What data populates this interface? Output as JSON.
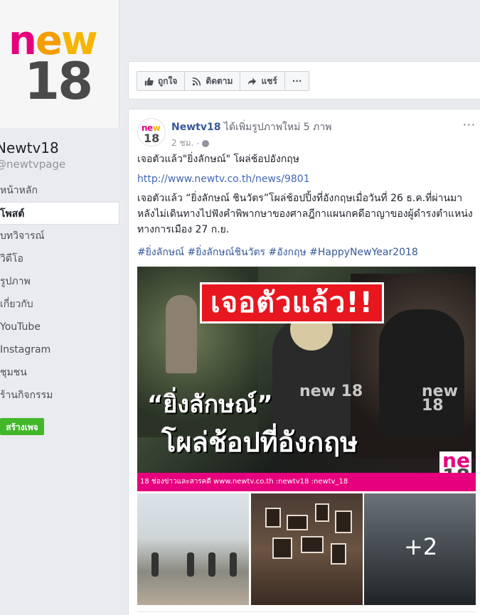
{
  "page": {
    "name": "Newtv18",
    "handle": "@newtvpage",
    "logo": {
      "top": "new",
      "bottom": "18"
    }
  },
  "nav": {
    "items": [
      {
        "label": "หน้าหลัก",
        "id": "home"
      },
      {
        "label": "โพสต์",
        "id": "posts",
        "active": true
      },
      {
        "label": "บทวิจารณ์",
        "id": "reviews"
      },
      {
        "label": "วิดีโอ",
        "id": "videos"
      },
      {
        "label": "รูปภาพ",
        "id": "photos"
      },
      {
        "label": "เกี่ยวกับ",
        "id": "about"
      },
      {
        "label": "YouTube",
        "id": "youtube"
      },
      {
        "label": "Instagram",
        "id": "instagram"
      },
      {
        "label": "ชุมชน",
        "id": "community"
      },
      {
        "label": "ร้านกิจกรรม",
        "id": "events"
      }
    ],
    "create_page_label": "สร้างเพจ"
  },
  "actions": {
    "like_label": "ถูกใจ",
    "follow_label": "ติดตาม",
    "share_label": "แชร์",
    "more_label": "···"
  },
  "post": {
    "author": "Newtv18",
    "action_text": "ได้เพิ่มรูปภาพใหม่ 5 ภาพ",
    "time": "2 ชม.",
    "title": "เจอตัวแล้ว\"ยิ่งลักษณ์\" โผล่ช้อปอังกฤษ",
    "link": "http://www.newtv.co.th/news/9801",
    "body": "เจอตัวแล้ว “ยิ่งลักษณ์ ชินวัตร”โผล่ช้อปปิ้งที่อังกฤษเมื่อวันที่ 26 ธ.ค.ที่ผ่านมา หลังไม่เดินทางไปฟังคำพิพากษาของศาลฎีกาแผนกคดีอาญาของผู้ดำรงตำแหน่งทางการเมือง 27 ก.ย.",
    "hashtags": "#ยิ่งลักษณ์ #ยิ่งลักษณ์ชินวัตร #อังกฤษ #HappyNewYear2018",
    "image": {
      "headline_top": "เจอตัวแล้ว!!",
      "headline_1": "“ยิ่งลักษณ์”",
      "headline_2": "โผล่ช้อปที่อังกฤษ",
      "watermark": "new 18",
      "bar_text": "18 ช่องข่าวและสารคดี   www.newtv.co.th   :newtv18   :newtv_18"
    },
    "more_photos": "+2"
  }
}
